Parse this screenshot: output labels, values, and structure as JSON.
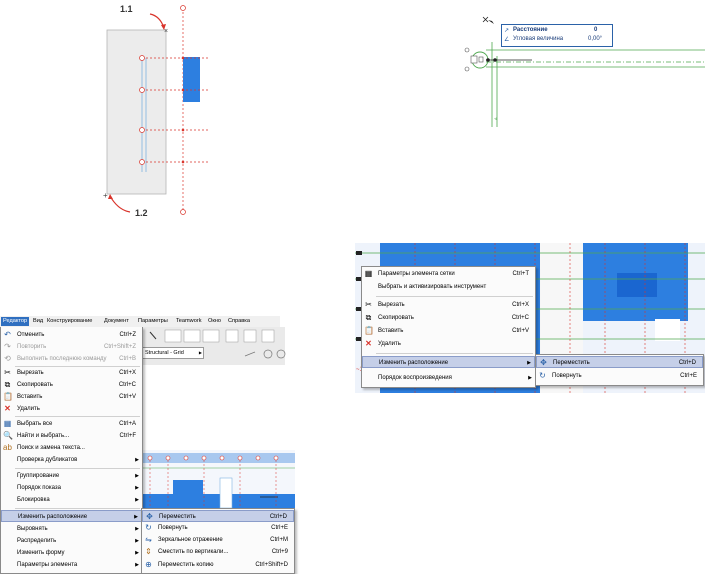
{
  "fig_top": {
    "labels": [
      "1.1",
      "1.2"
    ]
  },
  "tooltip": {
    "rows": [
      {
        "label": "Расстояние",
        "value": "0"
      },
      {
        "label": "Угловая величина",
        "value": "0,00°"
      }
    ]
  },
  "menubar": {
    "items": [
      "Редактор",
      "Вид",
      "Конструирование",
      "Документ",
      "Параметры",
      "Teamwork",
      "Окно",
      "Справка"
    ],
    "active": "Редактор"
  },
  "toolbar": {
    "grid_label": "Structural - Grid"
  },
  "edit_menu": {
    "items": [
      {
        "label": "Отменить",
        "shortcut": "Ctrl+Z",
        "icon": "undo-icon"
      },
      {
        "label": "Повторить",
        "shortcut": "Ctrl+Shift+Z",
        "icon": "redo-icon",
        "disabled": true
      },
      {
        "label": "Выполнить последнюю команду",
        "shortcut": "Ctrl+B",
        "icon": "repeat-icon",
        "disabled": true
      },
      {
        "label": "Вырезать",
        "shortcut": "Ctrl+X",
        "icon": "cut-icon"
      },
      {
        "label": "Скопировать",
        "shortcut": "Ctrl+C",
        "icon": "copy-icon"
      },
      {
        "label": "Вставить",
        "shortcut": "Ctrl+V",
        "icon": "paste-icon"
      },
      {
        "label": "Удалить",
        "shortcut": "",
        "icon": "delete-icon"
      },
      {
        "label": "Выбрать все",
        "shortcut": "Ctrl+A",
        "icon": "select-all-icon"
      },
      {
        "label": "Найти и выбрать...",
        "shortcut": "Ctrl+F",
        "icon": "find-icon"
      },
      {
        "label": "Поиск и замена текста...",
        "shortcut": "",
        "icon": "replace-icon"
      },
      {
        "label": "Проверка дубликатов",
        "shortcut": "",
        "submenu": true
      },
      {
        "label": "Группирование",
        "shortcut": "",
        "submenu": true
      },
      {
        "label": "Порядок показа",
        "shortcut": "",
        "submenu": true
      },
      {
        "label": "Блокировка",
        "shortcut": "",
        "submenu": true
      },
      {
        "label": "Изменить расположение",
        "shortcut": "",
        "submenu": true,
        "highlighted": true
      },
      {
        "label": "Выровнять",
        "shortcut": "",
        "submenu": true
      },
      {
        "label": "Распределить",
        "shortcut": "",
        "submenu": true
      },
      {
        "label": "Изменить форму",
        "shortcut": "",
        "submenu": true
      },
      {
        "label": "Параметры элемента",
        "shortcut": "",
        "submenu": true
      }
    ]
  },
  "move_submenu_left": {
    "items": [
      {
        "label": "Переместить",
        "shortcut": "Ctrl+D",
        "icon": "move-icon",
        "highlighted": true
      },
      {
        "label": "Повернуть",
        "shortcut": "Ctrl+E",
        "icon": "rotate-icon"
      },
      {
        "label": "Зеркальное отражение",
        "shortcut": "Ctrl+M",
        "icon": "mirror-icon"
      },
      {
        "label": "Сместить по вертикали...",
        "shortcut": "Ctrl+9",
        "icon": "elevate-icon"
      },
      {
        "label": "Переместить копию",
        "shortcut": "Ctrl+Shift+D",
        "icon": "move-copy-icon"
      }
    ]
  },
  "context_menu": {
    "items": [
      {
        "label": "Параметры элемента сетки",
        "shortcut": "Ctrl+T",
        "icon": "grid-settings-icon"
      },
      {
        "label": "Выбрать и активизировать инструмент",
        "shortcut": ""
      },
      {
        "label": "Вырезать",
        "shortcut": "Ctrl+X",
        "icon": "cut-icon"
      },
      {
        "label": "Скопировать",
        "shortcut": "Ctrl+C",
        "icon": "copy-icon"
      },
      {
        "label": "Вставить",
        "shortcut": "Ctrl+V",
        "icon": "paste-icon"
      },
      {
        "label": "Удалить",
        "shortcut": "",
        "icon": "delete-icon"
      },
      {
        "label": "Изменить расположение",
        "shortcut": "",
        "submenu": true,
        "highlighted": true
      },
      {
        "label": "Порядок воспроизведения",
        "shortcut": "",
        "submenu": true
      }
    ]
  },
  "move_submenu_right": {
    "items": [
      {
        "label": "Переместить",
        "shortcut": "Ctrl+D",
        "icon": "move-icon",
        "highlighted": true
      },
      {
        "label": "Повернуть",
        "shortcut": "Ctrl+E",
        "icon": "rotate-icon"
      }
    ]
  },
  "colors": {
    "menu_highlight": "#c5cfe8",
    "plan_blue": "#2d7fe0",
    "grid_red": "#d9342b",
    "grid_green": "#4fa84f"
  }
}
